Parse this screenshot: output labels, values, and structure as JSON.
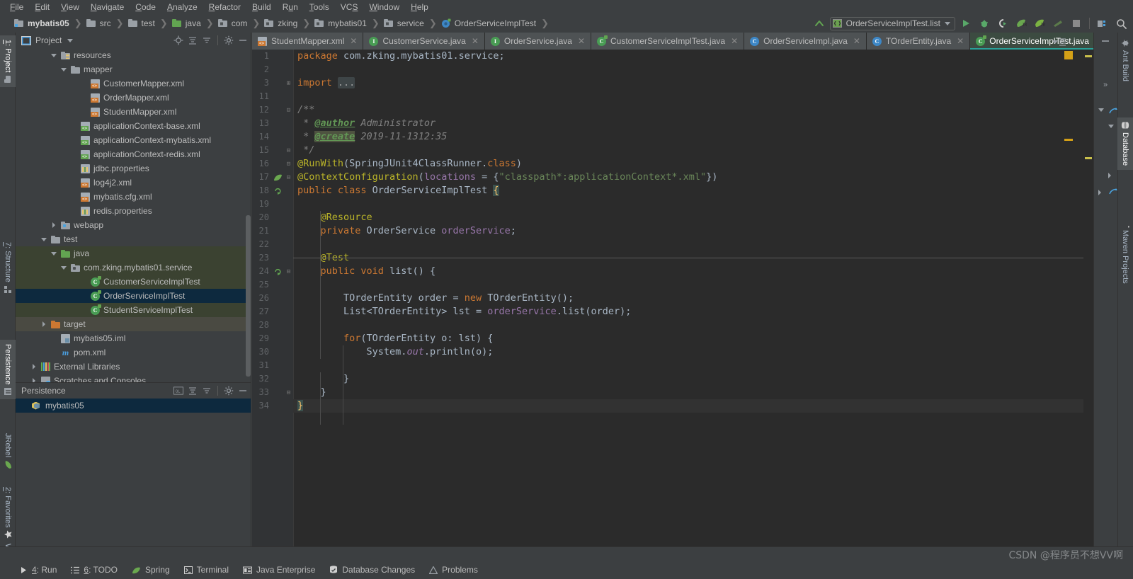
{
  "menu": {
    "items": [
      "File",
      "Edit",
      "View",
      "Navigate",
      "Code",
      "Analyze",
      "Refactor",
      "Build",
      "Run",
      "Tools",
      "VCS",
      "Window",
      "Help"
    ]
  },
  "breadcrumb": {
    "items": [
      {
        "label": "mybatis05",
        "icon": "module-icon"
      },
      {
        "label": "src",
        "icon": "folder-icon"
      },
      {
        "label": "test",
        "icon": "folder-icon"
      },
      {
        "label": "java",
        "icon": "source-folder-icon"
      },
      {
        "label": "com",
        "icon": "package-icon"
      },
      {
        "label": "zking",
        "icon": "package-icon"
      },
      {
        "label": "mybatis01",
        "icon": "package-icon"
      },
      {
        "label": "service",
        "icon": "package-icon"
      },
      {
        "label": "OrderServiceImplTest",
        "icon": "test-class-icon"
      }
    ]
  },
  "toolbar": {
    "run_configuration": "OrderServiceImplTest.list",
    "buttons": [
      "run-button",
      "debug-button",
      "run-with-coverage-button",
      "jrebel-run-button",
      "jrebel-debug-button",
      "build-button",
      "stop-button",
      "project-structure-button",
      "search-everywhere-button"
    ]
  },
  "left_tool_window_bar": {
    "items": [
      {
        "label": "1: Project",
        "active": true,
        "icon": "project-icon"
      },
      {
        "label": "7: Structure",
        "active": false,
        "icon": "structure-icon"
      },
      {
        "label": "Persistence",
        "active": true,
        "icon": "persistence-icon"
      },
      {
        "label": "JRebel",
        "active": false,
        "icon": "jrebel-icon"
      },
      {
        "label": "2: Favorites",
        "active": false,
        "icon": "star-icon"
      },
      {
        "label": "Web",
        "active": false,
        "icon": "web-icon"
      }
    ]
  },
  "right_tool_window_bar": {
    "items": [
      {
        "label": "Ant Build",
        "active": false,
        "icon": "ant-icon"
      },
      {
        "label": "Database",
        "active": true,
        "icon": "database-icon"
      },
      {
        "label": "Maven Projects",
        "active": false,
        "icon": "maven-icon"
      }
    ]
  },
  "project_panel": {
    "title": "Project",
    "header_icons": [
      "locate-icon",
      "expand-all-icon",
      "collapse-all-icon",
      "settings-gear-icon",
      "hide-icon"
    ],
    "tree": [
      {
        "label": "resources",
        "indent": 3,
        "arrow": "down",
        "icon": "resources-folder-icon",
        "state": "normal"
      },
      {
        "label": "mapper",
        "indent": 4,
        "arrow": "down",
        "icon": "folder-icon",
        "state": "normal"
      },
      {
        "label": "CustomerMapper.xml",
        "indent": 6,
        "arrow": "none",
        "icon": "xml-file-icon",
        "state": "normal"
      },
      {
        "label": "OrderMapper.xml",
        "indent": 6,
        "arrow": "none",
        "icon": "xml-file-icon",
        "state": "normal"
      },
      {
        "label": "StudentMapper.xml",
        "indent": 6,
        "arrow": "none",
        "icon": "xml-file-icon",
        "state": "normal"
      },
      {
        "label": "applicationContext-base.xml",
        "indent": 5,
        "arrow": "none",
        "icon": "spring-xml-file-icon",
        "state": "normal"
      },
      {
        "label": "applicationContext-mybatis.xml",
        "indent": 5,
        "arrow": "none",
        "icon": "spring-xml-file-icon",
        "state": "normal"
      },
      {
        "label": "applicationContext-redis.xml",
        "indent": 5,
        "arrow": "none",
        "icon": "spring-xml-file-icon",
        "state": "normal"
      },
      {
        "label": "jdbc.properties",
        "indent": 5,
        "arrow": "none",
        "icon": "properties-file-icon",
        "state": "normal"
      },
      {
        "label": "log4j2.xml",
        "indent": 5,
        "arrow": "none",
        "icon": "xml-file-icon",
        "state": "normal"
      },
      {
        "label": "mybatis.cfg.xml",
        "indent": 5,
        "arrow": "none",
        "icon": "xml-file-icon",
        "state": "normal"
      },
      {
        "label": "redis.properties",
        "indent": 5,
        "arrow": "none",
        "icon": "properties-file-icon",
        "state": "normal"
      },
      {
        "label": "webapp",
        "indent": 3,
        "arrow": "right",
        "icon": "web-folder-icon",
        "state": "normal"
      },
      {
        "label": "test",
        "indent": 2,
        "arrow": "down",
        "icon": "folder-icon",
        "state": "normal"
      },
      {
        "label": "java",
        "indent": 3,
        "arrow": "down",
        "icon": "source-folder-icon",
        "state": "source"
      },
      {
        "label": "com.zking.mybatis01.service",
        "indent": 4,
        "arrow": "down",
        "icon": "package-icon",
        "state": "source"
      },
      {
        "label": "CustomerServiceImplTest",
        "indent": 6,
        "arrow": "none",
        "icon": "test-class-icon",
        "state": "source"
      },
      {
        "label": "OrderServiceImplTest",
        "indent": 6,
        "arrow": "none",
        "icon": "test-class-icon",
        "state": "selected"
      },
      {
        "label": "StudentServiceImplTest",
        "indent": 6,
        "arrow": "none",
        "icon": "test-class-icon",
        "state": "source"
      },
      {
        "label": "target",
        "indent": 2,
        "arrow": "right",
        "icon": "target-folder-icon",
        "state": "highlight"
      },
      {
        "label": "mybatis05.iml",
        "indent": 3,
        "arrow": "none",
        "icon": "iml-file-icon",
        "state": "normal"
      },
      {
        "label": "pom.xml",
        "indent": 3,
        "arrow": "none",
        "icon": "maven-pom-icon",
        "state": "normal"
      },
      {
        "label": "External Libraries",
        "indent": 1,
        "arrow": "right",
        "icon": "library-icon",
        "state": "normal"
      },
      {
        "label": "Scratches and Consoles",
        "indent": 1,
        "arrow": "right",
        "icon": "scratches-icon",
        "state": "normal"
      }
    ]
  },
  "persistence_panel": {
    "title": "Persistence",
    "header_icons": [
      "console-sql-icon",
      "expand-all-icon",
      "collapse-all-icon",
      "settings-gear-icon",
      "hide-icon"
    ],
    "items": [
      {
        "label": "mybatis05",
        "icon": "datasource-icon",
        "selected": true
      }
    ]
  },
  "editor": {
    "tabs": [
      {
        "label": "StudentMapper.xml",
        "icon": "xml-file-icon",
        "active": false
      },
      {
        "label": "CustomerService.java",
        "icon": "interface-icon",
        "active": false
      },
      {
        "label": "OrderService.java",
        "icon": "interface-icon",
        "active": false
      },
      {
        "label": "CustomerServiceImplTest.java",
        "icon": "test-class-icon",
        "active": false
      },
      {
        "label": "OrderServiceImpl.java",
        "icon": "class-icon",
        "active": false
      },
      {
        "label": "TOrderEntity.java",
        "icon": "class-icon",
        "active": false
      },
      {
        "label": "OrderServiceImplTest.java",
        "icon": "test-class-icon",
        "active": true
      }
    ],
    "lines": [
      {
        "n": "1",
        "gutter": "",
        "fold": "",
        "text": "package com.zking.mybatis01.service;"
      },
      {
        "n": "2",
        "gutter": "",
        "fold": "",
        "text": ""
      },
      {
        "n": "3",
        "gutter": "",
        "fold": "+",
        "text": "import ..."
      },
      {
        "n": "11",
        "gutter": "",
        "fold": "",
        "text": ""
      },
      {
        "n": "12",
        "gutter": "",
        "fold": "-",
        "text": "/**"
      },
      {
        "n": "13",
        "gutter": "",
        "fold": "",
        "text": " * @author Administrator"
      },
      {
        "n": "14",
        "gutter": "",
        "fold": "",
        "text": " * @create 2019-11-1312:35"
      },
      {
        "n": "15",
        "gutter": "",
        "fold": "-",
        "text": " */"
      },
      {
        "n": "16",
        "gutter": "",
        "fold": "-",
        "text": "@RunWith(SpringJUnit4ClassRunner.class)"
      },
      {
        "n": "17",
        "gutter": "spring",
        "fold": "-",
        "text": "@ContextConfiguration(locations = {\"classpath*:applicationContext*.xml\"})"
      },
      {
        "n": "18",
        "gutter": "run",
        "fold": "",
        "text": "public class OrderServiceImplTest {"
      },
      {
        "n": "19",
        "gutter": "",
        "fold": "",
        "text": ""
      },
      {
        "n": "20",
        "gutter": "",
        "fold": "",
        "text": "    @Resource"
      },
      {
        "n": "21",
        "gutter": "",
        "fold": "",
        "text": "    private OrderService orderService;"
      },
      {
        "n": "22",
        "gutter": "",
        "fold": "",
        "text": ""
      },
      {
        "n": "23",
        "gutter": "",
        "fold": "",
        "text": "    @Test"
      },
      {
        "n": "24",
        "gutter": "run",
        "fold": "-",
        "text": "    public void list() {"
      },
      {
        "n": "25",
        "gutter": "",
        "fold": "",
        "text": ""
      },
      {
        "n": "26",
        "gutter": "",
        "fold": "",
        "text": "        TOrderEntity order = new TOrderEntity();"
      },
      {
        "n": "27",
        "gutter": "",
        "fold": "",
        "text": "        List<TOrderEntity> lst = orderService.list(order);"
      },
      {
        "n": "28",
        "gutter": "",
        "fold": "",
        "text": ""
      },
      {
        "n": "29",
        "gutter": "",
        "fold": "",
        "text": "        for(TOrderEntity o: lst) {"
      },
      {
        "n": "30",
        "gutter": "",
        "fold": "",
        "text": "            System.out.println(o);"
      },
      {
        "n": "31",
        "gutter": "",
        "fold": "",
        "text": ""
      },
      {
        "n": "32",
        "gutter": "",
        "fold": "",
        "text": "        }"
      },
      {
        "n": "33",
        "gutter": "",
        "fold": "-",
        "text": "    }"
      },
      {
        "n": "34",
        "gutter": "",
        "fold": "",
        "text": "}"
      }
    ]
  },
  "status_bar": {
    "items": [
      {
        "label": "4: Run",
        "icon": "run-icon",
        "underline": "4"
      },
      {
        "label": "6: TODO",
        "icon": "todo-icon",
        "underline": "6"
      },
      {
        "label": "Spring",
        "icon": "spring-leaf-icon",
        "underline": ""
      },
      {
        "label": "Terminal",
        "icon": "terminal-icon",
        "underline": ""
      },
      {
        "label": "Java Enterprise",
        "icon": "java-enterprise-icon",
        "underline": ""
      },
      {
        "label": "Database Changes",
        "icon": "database-changes-icon",
        "underline": ""
      },
      {
        "label": "Problems",
        "icon": "problems-icon",
        "underline": ""
      }
    ]
  },
  "watermark": "CSDN @程序员不想VV啊",
  "colors": {
    "background": "#3c3f41",
    "editor_background": "#2b2b2b",
    "selection": "#0d293e",
    "source_root": "#3b4231",
    "accent": "#2aa198",
    "keyword": "#cc7832",
    "string": "#6a8759",
    "annotation": "#bbb529",
    "field": "#9876aa",
    "comment_tag": "#629755",
    "text": "#a9b7c6"
  }
}
